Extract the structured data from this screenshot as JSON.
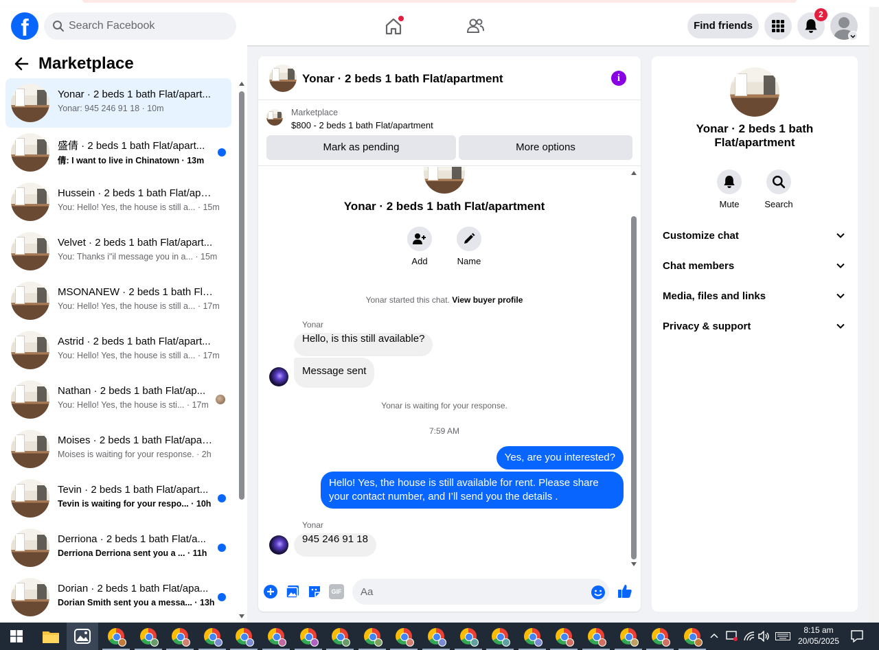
{
  "header": {
    "search_placeholder": "Search Facebook",
    "find_friends_label": "Find friends",
    "notification_count": "2",
    "logo_letter": "f"
  },
  "sidebar": {
    "title": "Marketplace",
    "conversations": [
      {
        "name": "Yonar · 2 beds 1 bath Flat/apart...",
        "preview": "Yonar: 945 246 91 18 · 10m",
        "active": true,
        "unread": false
      },
      {
        "name": "盛倩 · 2 beds 1 bath Flat/apart...",
        "preview": "倩: I want to live in Chinatown · 13m",
        "unread": true
      },
      {
        "name": "Hussein · 2 beds 1 bath Flat/apa...",
        "preview": "You: Hello! Yes, the house is still a... · 15m",
        "unread": false
      },
      {
        "name": "Velvet · 2 beds 1 bath Flat/apart...",
        "preview": "You: Thanks i\"il message you in a... · 15m",
        "unread": false
      },
      {
        "name": "MSONANEW · 2 beds 1 bath Flat...",
        "preview": "You: Hello! Yes, the house is still a... · 17m",
        "unread": false
      },
      {
        "name": "Astrid · 2 beds 1 bath Flat/apart...",
        "preview": "You: Hello! Yes, the house is still a... · 17m",
        "unread": false
      },
      {
        "name": "Nathan · 2 beds 1 bath Flat/ap...",
        "preview": "You: Hello! Yes, the house is sti... · 17m",
        "unread": false,
        "seen_avatar": true
      },
      {
        "name": "Moises · 2 beds 1 bath Flat/apart...",
        "preview": "Moises is waiting for your response. · 2h",
        "unread": false
      },
      {
        "name": "Tevin · 2 beds 1 bath Flat/apart...",
        "preview": "Tevin is waiting for your respo... · 10h",
        "unread": true
      },
      {
        "name": "Derriona · 2 beds 1 bath Flat/a...",
        "preview": "Derriona Derriona sent you a ... · 11h",
        "unread": true
      },
      {
        "name": "Dorian · 2 beds 1 bath Flat/apa...",
        "preview": "Dorian Smith sent you a messa... · 13h",
        "unread": true
      }
    ]
  },
  "chat": {
    "title": "Yonar · 2 beds 1 bath Flat/apartment",
    "marketplace_label": "Marketplace",
    "listing": "$800 - 2 beds 1 bath Flat/apartment",
    "mark_pending_label": "Mark as pending",
    "more_options_label": "More options",
    "profile_name": "Yonar · 2 beds 1 bath Flat/apartment",
    "add_label": "Add",
    "name_label": "Name",
    "started_text": "Yonar started this chat.",
    "view_buyer_label": "View buyer profile",
    "sender_1": "Yonar",
    "msg_in_1": "Hello, is this still available?",
    "msg_in_2": "Message sent",
    "waiting_text": "Yonar is waiting for your response.",
    "timestamp": "7:59 AM",
    "msg_out_1": "Yes, are you interested?",
    "msg_out_2": "Hello! Yes, the house is still available for rent. Please share your contact number, and I’ll send you the details .",
    "sender_2": "Yonar",
    "msg_in_3": "945 246 91 18",
    "composer_placeholder": "Aa",
    "gif_label": "GIF"
  },
  "details": {
    "name": "Yonar · 2 beds 1 bath Flat/apartment",
    "mute_label": "Mute",
    "search_label": "Search",
    "sections": [
      "Customize chat",
      "Chat members",
      "Media, files and links",
      "Privacy & support"
    ]
  },
  "taskbar": {
    "time": "8:15 am",
    "date": "20/05/2025"
  },
  "colors": {
    "accent": "#0866ff",
    "badge": "#e41e3f",
    "info": "#8a00e5"
  }
}
